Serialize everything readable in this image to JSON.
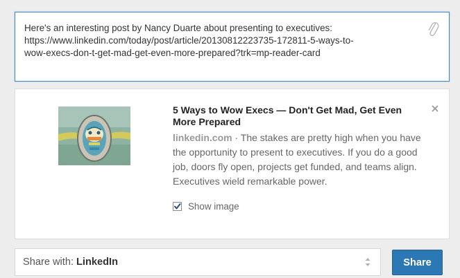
{
  "composer": {
    "text_line_1": "Here's an interesting post by Nancy Duarte about presenting to executives:",
    "text_line_2": "https://www.linkedin.com/today/post/article/20130812223735-172811-5-ways-to-",
    "text_line_3": "wow-execs-don-t-get-mad-get-even-more-prepared?trk=mp-reader-card",
    "attach_icon": "paperclip-icon"
  },
  "preview": {
    "title": "5 Ways to Wow Execs — Don't Get Mad, Get Even More Prepared",
    "source": "linkedin.com",
    "description": " · The stakes are pretty high when you have the opportunity to present to executives. If you do a good job, doors fly open, projects get funded, and teams align. Executives wield remarkable power.",
    "close_icon": "close-icon",
    "show_image_label": "Show image",
    "show_image_checked": true
  },
  "footer": {
    "share_with_label": "Share with:",
    "share_with_value": "LinkedIn",
    "share_button_label": "Share"
  },
  "colors": {
    "accent": "#2c78b5",
    "focus_border": "#3f87c6"
  }
}
